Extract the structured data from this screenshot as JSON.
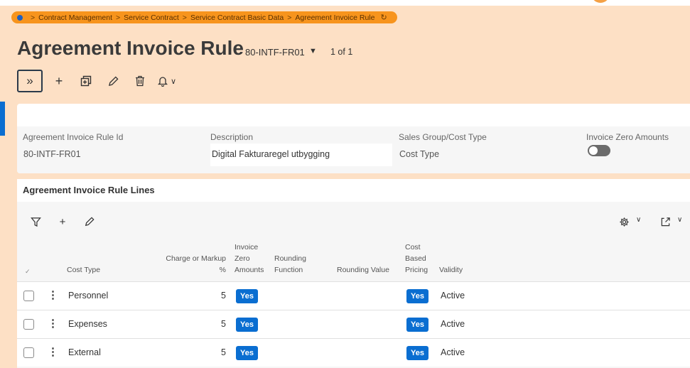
{
  "breadcrumb": {
    "items": [
      "Contract Management",
      "Service Contract",
      "Service Contract Basic Data",
      "Agreement Invoice Rule"
    ],
    "separator": ">",
    "refresh_icon": "refresh-icon"
  },
  "page": {
    "title": "Agreement Invoice Rule",
    "record_id": "80-INTF-FR01",
    "record_count": "1 of 1"
  },
  "toolbar": {
    "icons": [
      "expand-icon",
      "add-icon",
      "duplicate-icon",
      "edit-icon",
      "delete-icon",
      "bell-icon"
    ]
  },
  "header": {
    "fields": [
      {
        "label": "Agreement Invoice Rule Id",
        "value": "80-INTF-FR01"
      },
      {
        "label": "Description",
        "value": "Digital Fakturaregel utbygging"
      },
      {
        "label": "Sales Group/Cost Type",
        "value": "Cost Type"
      },
      {
        "label": "Invoice Zero Amounts",
        "value": false
      }
    ]
  },
  "lines": {
    "title": "Agreement Invoice Rule Lines",
    "columns": {
      "cost_type": "Cost Type",
      "charge_line1": "Charge or Markup",
      "charge_line2": "%",
      "izero_line1": "Invoice",
      "izero_line2": "Zero",
      "izero_line3": "Amounts",
      "round_fn_line1": "Rounding",
      "round_fn_line2": "Function",
      "round_val": "Rounding Value",
      "cbp_line1": "Cost",
      "cbp_line2": "Based",
      "cbp_line3": "Pricing",
      "validity": "Validity"
    },
    "rows": [
      {
        "cost_type": "Personnel",
        "charge": "5",
        "invoice_zero": "Yes",
        "cost_based": "Yes",
        "validity": "Active"
      },
      {
        "cost_type": "Expenses",
        "charge": "5",
        "invoice_zero": "Yes",
        "cost_based": "Yes",
        "validity": "Active"
      },
      {
        "cost_type": "External",
        "charge": "5",
        "invoice_zero": "Yes",
        "cost_based": "Yes",
        "validity": "Active"
      }
    ]
  },
  "colors": {
    "accent": "#0a6ed1",
    "breadcrumb_bg": "#f7941d",
    "page_bg": "#fde0c5"
  }
}
